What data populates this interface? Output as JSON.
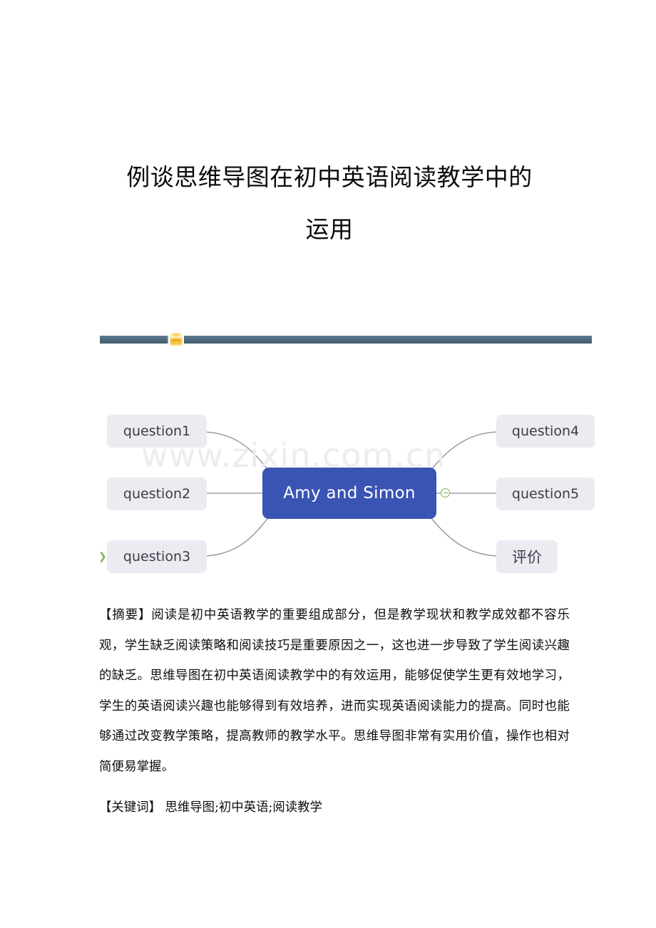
{
  "document": {
    "title_line1": "例谈思维导图在初中英语阅读教学中的",
    "title_line2": "运用",
    "abstract": "【摘要】阅读是初中英语教学的重要组成部分，但是教学现状和教学成效都不容乐观，学生缺乏阅读策略和阅读技巧是重要原因之一，这也进一步导致了学生阅读兴趣的缺乏。思维导图在初中英语阅读教学中的有效运用，能够促使学生更有效地学习，学生的英语阅读兴趣也能够得到有效培养，进而实现英语阅读能力的提高。同时也能够通过改变教学策略，提高教师的教学水平。思维导图非常有实用价值，操作也相对简便易掌握。",
    "keywords": "【关键词】  思维导图;初中英语;阅读教学"
  },
  "divider": {
    "bar_color": "#4b667b",
    "marker_color": "#f2c02a"
  },
  "figure": {
    "watermark": "www.zixin.com.cn",
    "center_node": "Amy and Simon",
    "center_color": "#3a54b4",
    "node_color": "#ebebf2",
    "branch_color": "#79b558",
    "left_nodes": [
      {
        "label": "question1"
      },
      {
        "label": "question2"
      },
      {
        "label": "question3"
      }
    ],
    "right_nodes": [
      {
        "label": "question4"
      },
      {
        "label": "question5"
      },
      {
        "label": "评价"
      }
    ]
  }
}
